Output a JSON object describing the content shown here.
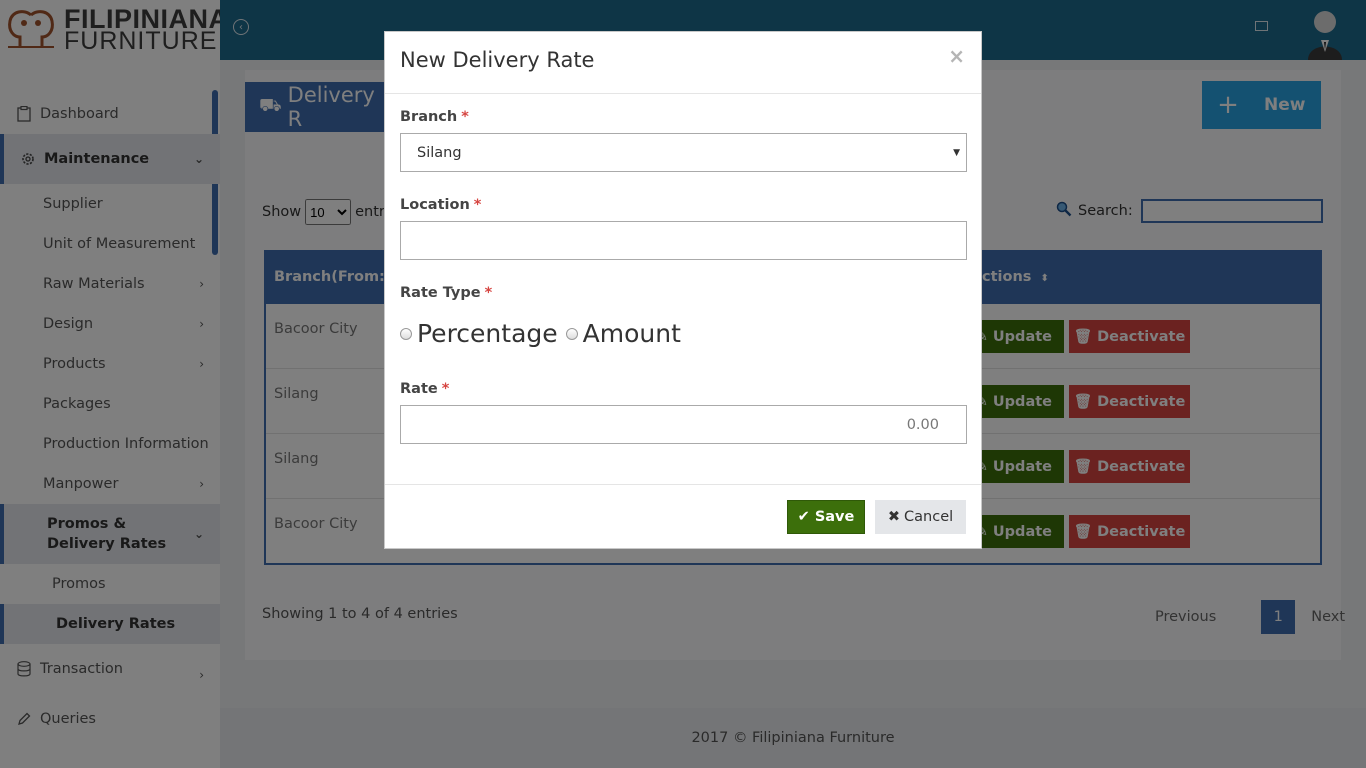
{
  "brand": {
    "line1": "FILIPINIANA",
    "line2": "FURNITURE"
  },
  "sidebar": {
    "items": [
      {
        "label": "Dashboard"
      },
      {
        "label": "Maintenance"
      },
      {
        "label": "Supplier"
      },
      {
        "label": "Unit of Measurement"
      },
      {
        "label": "Raw Materials"
      },
      {
        "label": "Design"
      },
      {
        "label": "Products"
      },
      {
        "label": "Packages"
      },
      {
        "label": "Production Information"
      },
      {
        "label": "Manpower"
      },
      {
        "label": "Promos & Delivery Rates"
      },
      {
        "label": "Promos"
      },
      {
        "label": "Delivery Rates"
      },
      {
        "label": "Transaction"
      },
      {
        "label": "Queries"
      }
    ]
  },
  "page": {
    "title": "Delivery R",
    "new_button": "New",
    "show_label": "Show",
    "show_value": "10",
    "entries_label": "entr",
    "search_label": "Search:"
  },
  "table": {
    "columns": [
      "Branch(From:)",
      "ctions"
    ],
    "rows": [
      {
        "branch": "Bacoor City"
      },
      {
        "branch": "Silang"
      },
      {
        "branch": "Silang"
      },
      {
        "branch": "Bacoor City"
      }
    ],
    "update_label": "Update",
    "deactivate_label": "Deactivate"
  },
  "pagination": {
    "summary": "Showing 1 to 4 of 4 entries",
    "previous": "Previous",
    "current": "1",
    "next": "Next"
  },
  "footer": {
    "text": "2017 © Filipiniana Furniture"
  },
  "modal": {
    "title": "New Delivery Rate",
    "close": "×",
    "branch_label": "Branch",
    "branch_value": "Silang",
    "location_label": "Location",
    "location_value": "",
    "rate_type_label": "Rate Type",
    "rate_type_options": [
      "Percentage",
      "Amount"
    ],
    "rate_label": "Rate",
    "rate_value": "0.00",
    "required_mark": "*",
    "save": "Save",
    "cancel": "Cancel"
  },
  "colors": {
    "topbar": "#1d6a8d",
    "accent": "#3f6dae",
    "save": "#3c6f0b",
    "danger": "#d64541",
    "new_button": "#29a3e3"
  }
}
